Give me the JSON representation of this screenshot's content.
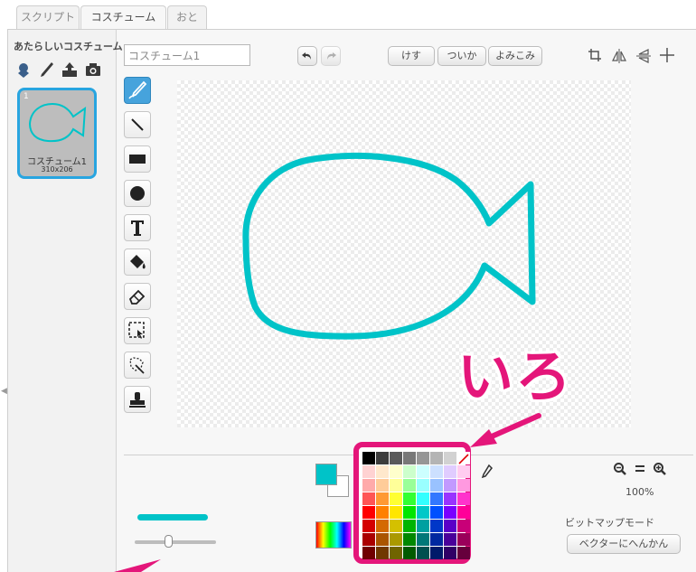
{
  "tabs": [
    {
      "label": "スクリプト"
    },
    {
      "label": "コスチューム"
    },
    {
      "label": "おと"
    }
  ],
  "active_tab": "コスチューム",
  "new_costume": {
    "label": "あたらしいコスチューム",
    "icons": [
      "paint-icon",
      "brush-icon",
      "upload-icon",
      "camera-icon"
    ]
  },
  "costumes": [
    {
      "index": "1",
      "name": "コスチューム1",
      "size": "310x206"
    }
  ],
  "costume_name_field": {
    "value": "コスチューム1"
  },
  "toolbar": {
    "undo_icon": "undo-icon",
    "redo_icon": "redo-icon",
    "clear_label": "けす",
    "add_label": "ついか",
    "import_label": "よみこみ",
    "right_icons": [
      "crop-icon",
      "flip-horizontal-icon",
      "flip-vertical-icon",
      "set-center-icon"
    ]
  },
  "tools": [
    "brush-icon",
    "line-icon",
    "rectangle-icon",
    "ellipse-icon",
    "text-icon",
    "fill-icon",
    "eraser-icon",
    "select-icon",
    "magic-select-icon",
    "stamp-icon"
  ],
  "active_tool": "brush-icon",
  "bottom": {
    "zoom_level": "100%",
    "zoom_out_icon": "zoom-out-icon",
    "zoom_reset_icon": "zoom-reset-icon",
    "zoom_in_icon": "zoom-in-icon",
    "mode_label": "ビットマップモード",
    "convert_vector_label": "ベクターにへんかん",
    "line_width_fraction": 0.42
  },
  "colors": {
    "selected": "#00c3c8",
    "accent": "#e4167a",
    "tab_active_border": "#28a5e0"
  },
  "palette": [
    "#000000",
    "#3c3c3c",
    "#5a5a5a",
    "#787878",
    "#969696",
    "#b4b4b4",
    "#d2d2d2",
    "#ffffff",
    "#ffd2d2",
    "#ffe8cc",
    "#ffffcc",
    "#ccffcc",
    "#ccffff",
    "#cce0ff",
    "#e0ccff",
    "#ffccf0",
    "#ffaaaa",
    "#ffcc99",
    "#ffff99",
    "#99ff99",
    "#99ffff",
    "#99c2ff",
    "#c299ff",
    "#ff99e0",
    "#ff5555",
    "#ff9933",
    "#ffff33",
    "#33ff33",
    "#33ffff",
    "#3377ff",
    "#9933ff",
    "#ff33cc",
    "#ff0000",
    "#ff8000",
    "#ffe600",
    "#00e600",
    "#00c8c8",
    "#0050ff",
    "#7a00ff",
    "#ff0099",
    "#d40000",
    "#d46a00",
    "#d4c000",
    "#00b400",
    "#00a0a0",
    "#0037c8",
    "#5a00c8",
    "#c80078",
    "#aa0000",
    "#aa5500",
    "#aa9900",
    "#008800",
    "#007878",
    "#0028a0",
    "#4a009a",
    "#9a005a",
    "#700000",
    "#703800",
    "#706400",
    "#005a00",
    "#004f4f",
    "#001a6a",
    "#300066",
    "#66003c"
  ],
  "annotation": {
    "label": "いろ"
  }
}
